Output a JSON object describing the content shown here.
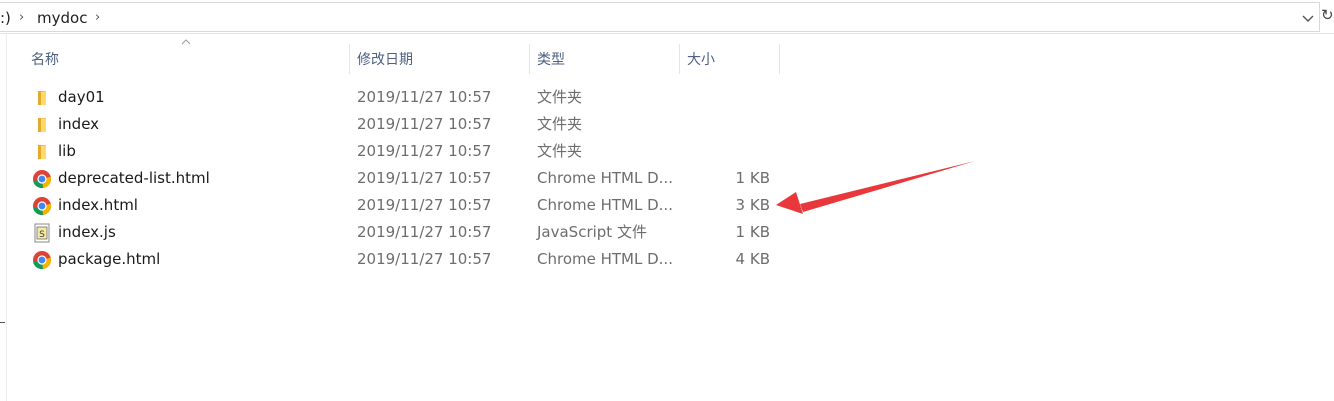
{
  "address": {
    "drive_fragment": ":)",
    "folder": "mydoc"
  },
  "columns": {
    "name": "名称",
    "date": "修改日期",
    "type": "类型",
    "size": "大小"
  },
  "files": [
    {
      "name": "day01",
      "date": "2019/11/27 10:57",
      "type": "文件夹",
      "size": "",
      "icon": "folder-icon"
    },
    {
      "name": "index",
      "date": "2019/11/27 10:57",
      "type": "文件夹",
      "size": "",
      "icon": "folder-icon"
    },
    {
      "name": "lib",
      "date": "2019/11/27 10:57",
      "type": "文件夹",
      "size": "",
      "icon": "folder-icon"
    },
    {
      "name": "deprecated-list.html",
      "date": "2019/11/27 10:57",
      "type": "Chrome HTML D...",
      "size": "1 KB",
      "icon": "chrome-icon"
    },
    {
      "name": "index.html",
      "date": "2019/11/27 10:57",
      "type": "Chrome HTML D...",
      "size": "3 KB",
      "icon": "chrome-icon"
    },
    {
      "name": "index.js",
      "date": "2019/11/27 10:57",
      "type": "JavaScript 文件",
      "size": "1 KB",
      "icon": "js-file-icon"
    },
    {
      "name": "package.html",
      "date": "2019/11/27 10:57",
      "type": "Chrome HTML D...",
      "size": "4 KB",
      "icon": "chrome-icon"
    }
  ],
  "annotation": {
    "arrow_color": "#e8383b"
  }
}
